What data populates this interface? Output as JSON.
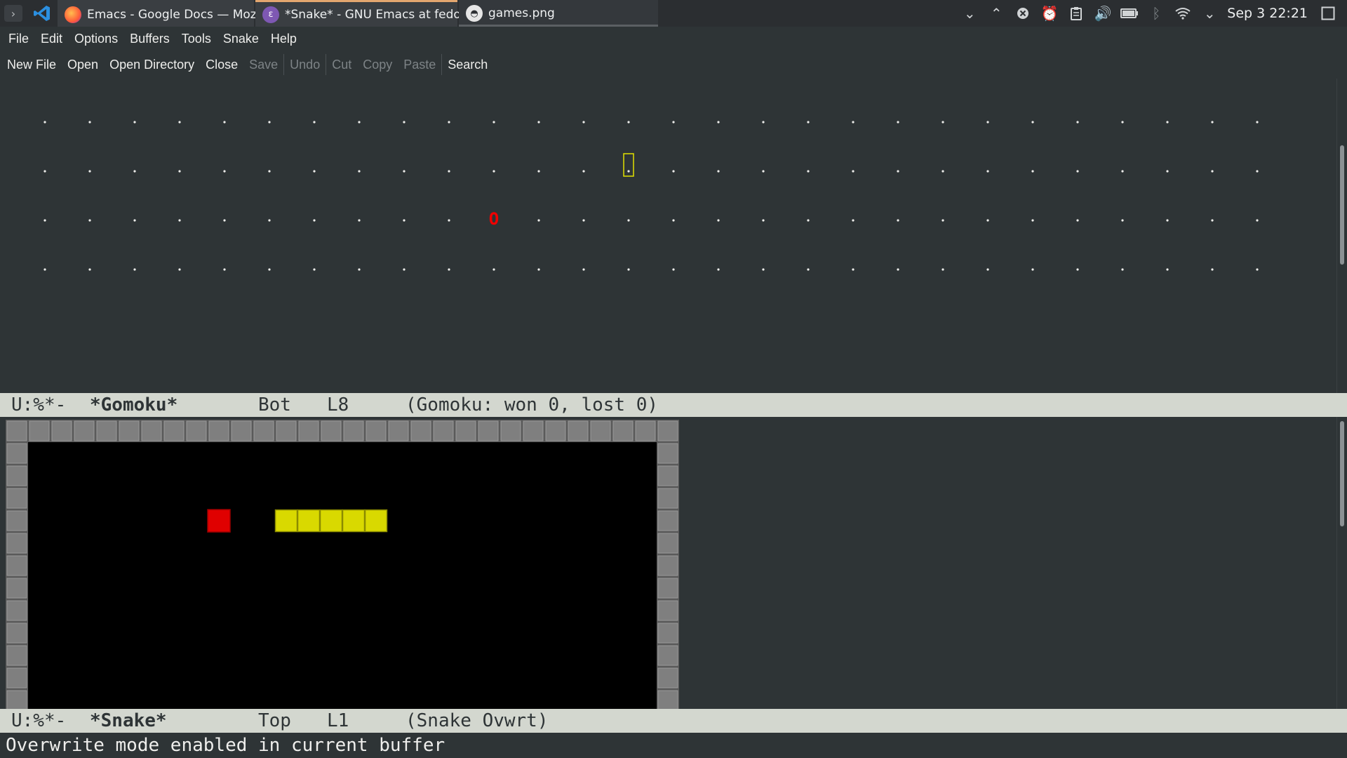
{
  "taskbar": {
    "tasks": [
      {
        "title": "Emacs - Google Docs — Mozill...",
        "icon": "firefox-icon"
      },
      {
        "title": "*Snake* - GNU Emacs at fedora",
        "icon": "emacs-icon"
      },
      {
        "title": "games.png",
        "icon": "image-viewer-icon"
      }
    ],
    "clock": "Sep 3 22:21"
  },
  "menubar": [
    "File",
    "Edit",
    "Options",
    "Buffers",
    "Tools",
    "Snake",
    "Help"
  ],
  "toolbar": {
    "new_file": "New File",
    "open": "Open",
    "open_directory": "Open Directory",
    "close": "Close",
    "save": "Save",
    "undo": "Undo",
    "cut": "Cut",
    "copy": "Copy",
    "paste": "Paste",
    "search": "Search"
  },
  "gomoku": {
    "columns": 28,
    "rows": 4,
    "cursor": {
      "row": 2,
      "col": 14
    },
    "stones": [
      {
        "row": 3,
        "col": 11,
        "glyph": "O",
        "color": "#ef0000"
      }
    ],
    "modeline": {
      "state": "U:%*-",
      "buffer": "*Gomoku*",
      "position": "Bot",
      "line": "L8",
      "modes": "(Gomoku: won 0, lost 0)"
    }
  },
  "snake": {
    "border_color": "#7f7f7f",
    "field_color": "#000000",
    "snake_color": "#d9d900",
    "food_color": "#e00000",
    "food": {
      "row": 4,
      "col": 9
    },
    "body": [
      {
        "row": 4,
        "col": 12
      },
      {
        "row": 4,
        "col": 13
      },
      {
        "row": 4,
        "col": 14
      },
      {
        "row": 4,
        "col": 15
      },
      {
        "row": 4,
        "col": 16
      }
    ],
    "modeline": {
      "state": "U:%*-",
      "buffer": "*Snake*",
      "position": "Top",
      "line": "L1",
      "modes": "(Snake Ovwrt)"
    }
  },
  "echo": "Overwrite mode enabled in current buffer"
}
